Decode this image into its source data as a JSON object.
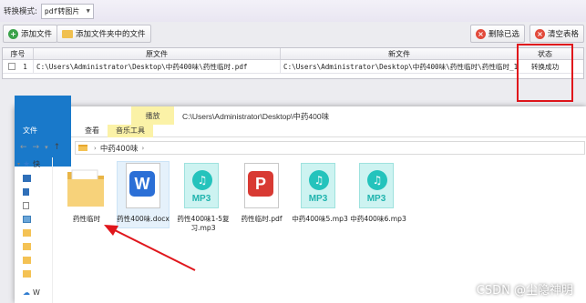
{
  "converter": {
    "mode_label": "转换模式:",
    "mode_value": "pdf转图片",
    "toolbar": {
      "add_file": "添加文件",
      "add_folder": "添加文件夹中的文件",
      "delete_selected": "删除已选",
      "clear_table": "清空表格"
    },
    "table": {
      "headers": [
        "序号",
        "原文件",
        "新文件",
        "状态"
      ],
      "rows": [
        {
          "index": "1",
          "source": "C:\\Users\\Administrator\\Desktop\\中药400味\\药性临时.pdf",
          "target": "C:\\Users\\Administrator\\Desktop\\中药400味\\药性临时\\药性临时_1.jpg",
          "status": "转换成功"
        }
      ]
    },
    "colors": {
      "highlight_box": "#e0161c",
      "add_icon": "#3aa24a",
      "delete_icon": "#e24a3b"
    }
  },
  "explorer": {
    "title_path": "C:\\Users\\Administrator\\Desktop\\中药400味",
    "context_tab": "播放",
    "ribbon_tabs": [
      "文件",
      "主页",
      "共享",
      "查看",
      "音乐工具"
    ],
    "address": {
      "crumbs": [
        "中药400味"
      ]
    },
    "sidebar": [
      {
        "label": "快",
        "icon": "star-icon"
      },
      {
        "label": "",
        "icon": "folder-icon"
      },
      {
        "label": "",
        "icon": "download-icon"
      },
      {
        "label": "",
        "icon": "document-icon"
      },
      {
        "label": "",
        "icon": "picture-icon"
      },
      {
        "label": "",
        "icon": "folder-icon"
      },
      {
        "label": "",
        "icon": "folder-icon"
      },
      {
        "label": "",
        "icon": "folder-icon"
      },
      {
        "label": "",
        "icon": "folder-icon"
      },
      {
        "label": "W",
        "icon": "cloud-icon"
      }
    ],
    "files": [
      {
        "name": "药性临时",
        "type": "folder"
      },
      {
        "name": "药性400味.docx",
        "type": "word"
      },
      {
        "name": "药性400味1-5复习.mp3",
        "type": "mp3"
      },
      {
        "name": "药性临时.pdf",
        "type": "pdf"
      },
      {
        "name": "中药400味5.mp3",
        "type": "mp3"
      },
      {
        "name": "中药400味6.mp3",
        "type": "mp3"
      }
    ],
    "mp3_label": "MP3"
  },
  "watermark": "CSDN @尘隐神明"
}
